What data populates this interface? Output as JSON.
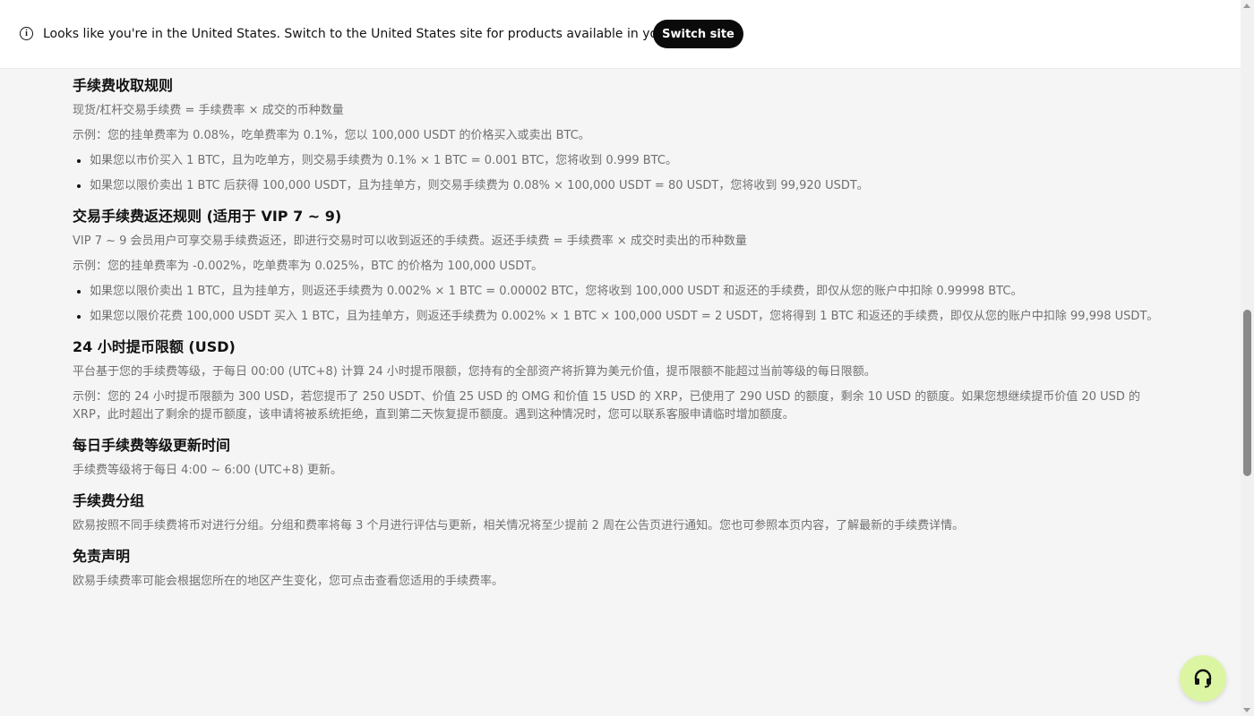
{
  "banner": {
    "message": "Looks like you're in the United States. Switch to the United States site for products available in your region.",
    "switch_label": "Switch site",
    "icon": "info-icon"
  },
  "sections": [
    {
      "title": "手续费收取规则",
      "paragraphs": [
        "现货/杠杆交易手续费 = 手续费率 × 成交的币种数量",
        "示例：您的挂单费率为 0.08%，吃单费率为 0.1%，您以 100,000 USDT 的价格买入或卖出 BTC。"
      ],
      "bullets": [
        "如果您以市价买入 1 BTC，且为吃单方，则交易手续费为 0.1% × 1 BTC = 0.001 BTC，您将收到 0.999 BTC。",
        "如果您以限价卖出 1 BTC 后获得 100,000 USDT，且为挂单方，则交易手续费为 0.08% × 100,000 USDT = 80 USDT，您将收到 99,920 USDT。"
      ]
    },
    {
      "title": "交易手续费返还规则 (适用于 VIP 7 ~ 9)",
      "paragraphs": [
        "VIP 7 ~ 9 会员用户可享交易手续费返还，即进行交易时可以收到返还的手续费。返还手续费 = 手续费率 × 成交时卖出的币种数量",
        "示例：您的挂单费率为 -0.002%，吃单费率为 0.025%，BTC 的价格为 100,000 USDT。"
      ],
      "bullets": [
        "如果您以限价卖出 1 BTC，且为挂单方，则返还手续费为 0.002% × 1 BTC = 0.00002 BTC，您将收到 100,000 USDT 和返还的手续费，即仅从您的账户中扣除 0.99998 BTC。",
        "如果您以限价花费 100,000 USDT 买入 1 BTC，且为挂单方，则返还手续费为 0.002% × 1 BTC × 100,000 USDT = 2 USDT，您将得到 1 BTC 和返还的手续费，即仅从您的账户中扣除 99,998 USDT。"
      ]
    },
    {
      "title": "24 小时提币限额 (USD)",
      "paragraphs": [
        "平台基于您的手续费等级，于每日 00:00 (UTC+8) 计算 24 小时提币限额，您持有的全部资产将折算为美元价值，提币限额不能超过当前等级的每日限额。",
        "示例：您的 24 小时提币限额为 300 USD，若您提币了 250 USDT、价值 25 USD 的 OMG 和价值 15 USD 的 XRP，已使用了 290 USD 的额度，剩余 10 USD 的额度。如果您想继续提币价值 20 USD 的 XRP，此时超出了剩余的提币额度，该申请将被系统拒绝，直到第二天恢复提币额度。遇到这种情况时，您可以联系客服申请临时增加额度。"
      ],
      "bullets": []
    },
    {
      "title": "每日手续费等级更新时间",
      "paragraphs": [
        "手续费等级将于每日 4:00 ~ 6:00 (UTC+8) 更新。"
      ],
      "bullets": []
    },
    {
      "title": "手续费分组",
      "paragraphs": [
        "欧易按照不同手续费将币对进行分组。分组和费率将每 3 个月进行评估与更新，相关情况将至少提前 2 周在公告页进行通知。您也可参照本页内容，了解最新的手续费详情。"
      ],
      "bullets": []
    },
    {
      "title": "免责声明",
      "paragraphs": [
        "欧易手续费率可能会根据您所在的地区产生变化，您可点击查看您适用的手续费率。"
      ],
      "bullets": []
    }
  ],
  "support": {
    "icon": "headset-icon",
    "color": "#dcf5a3"
  }
}
